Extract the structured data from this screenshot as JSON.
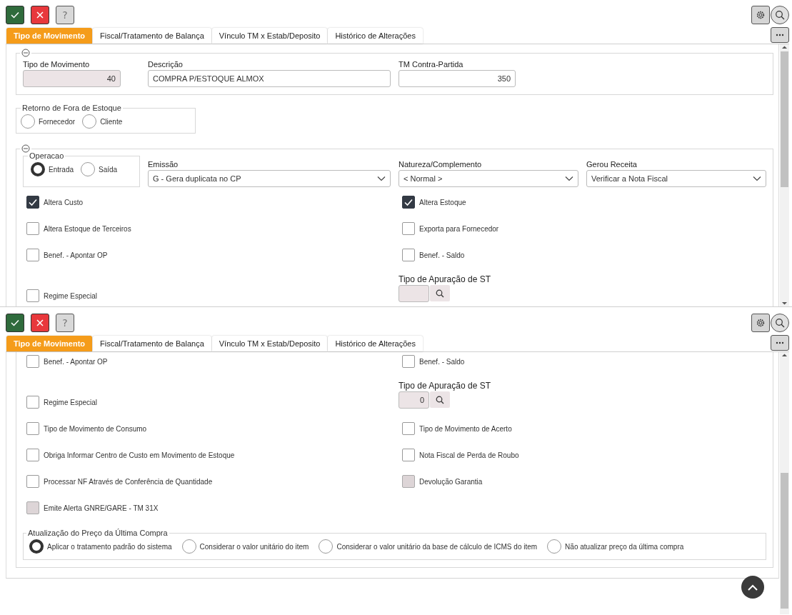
{
  "views": [
    {
      "help_label": "?",
      "tabs": [
        {
          "label": "Tipo de Movimento",
          "selected": true
        },
        {
          "label": "Fiscal/Tratamento de Balança",
          "selected": false
        },
        {
          "label": "Vínculo TM x Estab/Deposito",
          "selected": false
        },
        {
          "label": "Histórico de Alterações",
          "selected": false
        }
      ],
      "content": [
        {
          "kind": "fields",
          "expanded": true,
          "fields": [
            {
              "label": "Tipo de Movimento",
              "value": "40",
              "kind": "number",
              "readonly": true
            },
            {
              "label": "Descrição",
              "value": "COMPRA P/ESTOQUE ALMOX",
              "kind": "text",
              "readonly": false
            },
            {
              "label": "TM Contra-Partida",
              "value": "350",
              "kind": "number",
              "readonly": false
            }
          ]
        },
        {
          "kind": "radio_group",
          "title": "Retorno de Fora de Estoque",
          "options": [
            {
              "label": "Fornecedor",
              "selected": false
            },
            {
              "label": "Cliente",
              "selected": false
            }
          ]
        },
        {
          "kind": "section",
          "expanded": true,
          "operation": {
            "title": "Operacao",
            "options": [
              {
                "label": "Entrada",
                "selected": true
              },
              {
                "label": "Saída",
                "selected": false
              }
            ]
          },
          "selects": [
            {
              "label": "Emissão",
              "value": "G - Gera duplicata no CP"
            },
            {
              "label": "Natureza/Complemento",
              "value": "< Normal >"
            },
            {
              "label": "Gerou Receita",
              "value": "Verificar a Nota Fiscal"
            }
          ],
          "rows": [
            {
              "left": {
                "kind": "checkbox",
                "label": "Altera Custo",
                "checked": true,
                "disabled": false
              },
              "right": {
                "kind": "checkbox",
                "label": "Altera Estoque",
                "checked": true,
                "disabled": false
              }
            },
            {
              "left": {
                "kind": "checkbox",
                "label": "Altera Estoque de Terceiros",
                "checked": false,
                "disabled": false
              },
              "right": {
                "kind": "checkbox",
                "label": "Exporta para Fornecedor",
                "checked": false,
                "disabled": false
              }
            },
            {
              "left": {
                "kind": "checkbox",
                "label": "Benef. - Apontar OP",
                "checked": false,
                "disabled": false
              },
              "right": {
                "kind": "checkbox",
                "label": "Benef. - Saldo",
                "checked": false,
                "disabled": false
              }
            },
            {
              "left": {
                "kind": "checkbox",
                "label": "Regime Especial",
                "checked": false,
                "disabled": false
              },
              "right": {
                "kind": "lookup",
                "label": "Tipo de Apuração de ST"
              }
            }
          ]
        }
      ]
    },
    {
      "help_label": "?",
      "tabs": [
        {
          "label": "Tipo de Movimento",
          "selected": true
        },
        {
          "label": "Fiscal/Tratamento de Balança",
          "selected": false
        },
        {
          "label": "Vínculo TM x Estab/Deposito",
          "selected": false
        },
        {
          "label": "Histórico de Alterações",
          "selected": false
        }
      ],
      "content": [
        {
          "kind": "section",
          "rows": [
            {
              "left": {
                "kind": "checkbox",
                "label": "Benef. - Apontar OP",
                "checked": false,
                "disabled": false
              },
              "right": {
                "kind": "checkbox",
                "label": "Benef. - Saldo",
                "checked": false,
                "disabled": false
              }
            },
            {
              "left": {
                "kind": "checkbox",
                "label": "Regime Especial",
                "checked": false,
                "disabled": false
              },
              "right": {
                "kind": "lookup",
                "label": "Tipo de Apuração de ST",
                "value": "0"
              }
            },
            {
              "left": {
                "kind": "checkbox",
                "label": "Tipo de Movimento de Consumo",
                "checked": false,
                "disabled": false
              },
              "right": {
                "kind": "checkbox",
                "label": "Tipo de Movimento de Acerto",
                "checked": false,
                "disabled": false
              }
            },
            {
              "left": {
                "kind": "checkbox",
                "label": "Obriga Informar Centro de Custo em Movimento de Estoque",
                "checked": false,
                "disabled": false
              },
              "right": {
                "kind": "checkbox",
                "label": "Nota Fiscal de Perda de Roubo",
                "checked": false,
                "disabled": false
              }
            },
            {
              "left": {
                "kind": "checkbox",
                "label": "Processar NF Através de Conferência de Quantidade",
                "checked": false,
                "disabled": false
              },
              "right": {
                "kind": "checkbox",
                "label": "Devolução Garantia",
                "checked": false,
                "disabled": true
              }
            },
            {
              "left": {
                "kind": "checkbox",
                "label": "Emite Alerta GNRE/GARE - TM 31X",
                "checked": false,
                "disabled": true
              }
            }
          ],
          "price": {
            "title": "Atualização do Preço da Última Compra",
            "options": [
              {
                "label": "Aplicar o tratamento padrão do sistema",
                "selected": true
              },
              {
                "label": "Considerar o valor unitário do item",
                "selected": false
              },
              {
                "label": "Considerar o valor unitário da base de cálculo de ICMS do item",
                "selected": false
              },
              {
                "label": "Não atualizar preço da última compra",
                "selected": false
              }
            ]
          }
        }
      ]
    }
  ]
}
